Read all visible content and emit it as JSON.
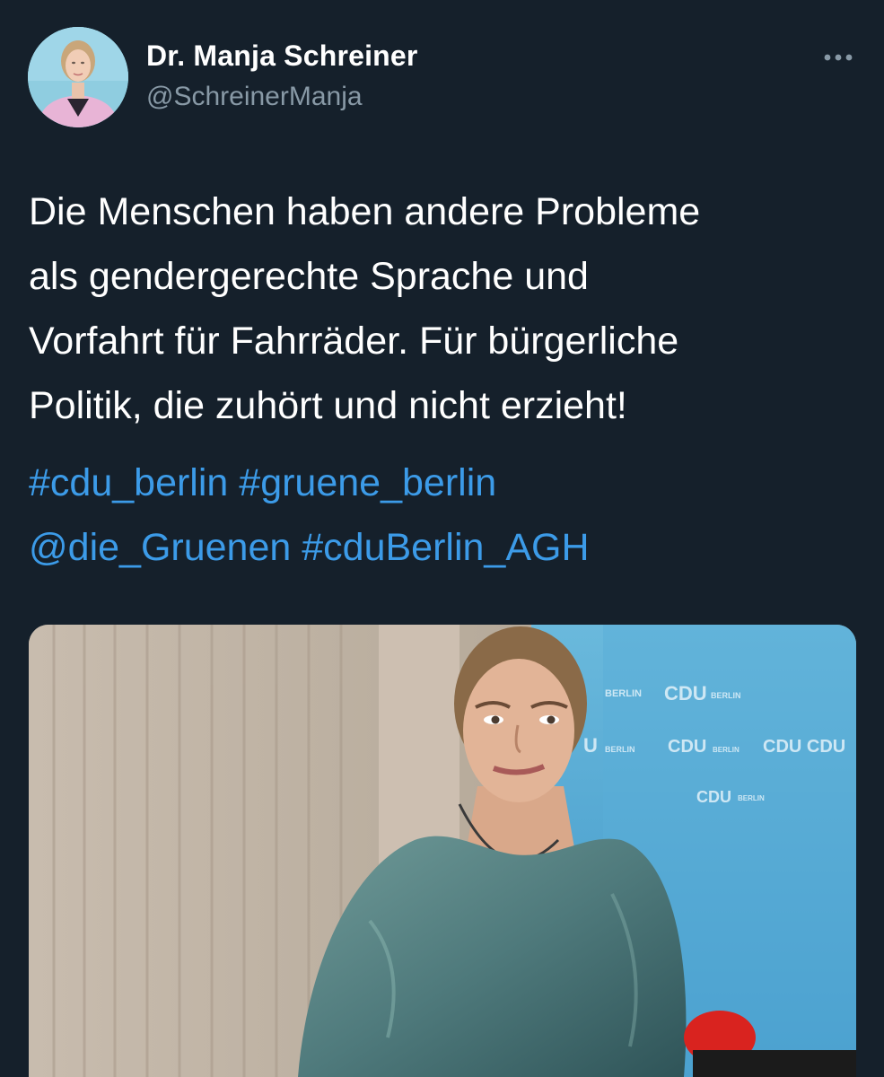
{
  "author": {
    "display_name": "Dr. Manja Schreiner",
    "handle": "@SchreinerManja",
    "avatar_icon": "profile-photo"
  },
  "more_icon": "more-horizontal-icon",
  "tweet": {
    "text_lines": [
      "Die Menschen haben andere Probleme",
      "als gendergerechte Sprache und",
      "Vorfahrt für Fahrräder. Für bürgerliche",
      "Politik, die zuhört und nicht erzieht!"
    ],
    "hashtags": {
      "cdu_berlin": "#cdu_berlin",
      "gruene_berlin": "#gruene_berlin",
      "die_gruenen": "@die_Gruenen",
      "cduberlin_agh": "#cduBerlin_AGH"
    }
  },
  "media": {
    "backdrop_texts": [
      "BERLIN",
      "CDU",
      "BERLIN",
      "U",
      "BERLIN",
      "CDU",
      "BERLIN",
      "CDU CDU",
      "CDU",
      "BERLIN"
    ]
  },
  "colors": {
    "background": "#15202b",
    "text": "#ffffff",
    "secondary_text": "#8899a6",
    "link": "#3c9be8",
    "cdu_backdrop": "#5eb1d4"
  }
}
